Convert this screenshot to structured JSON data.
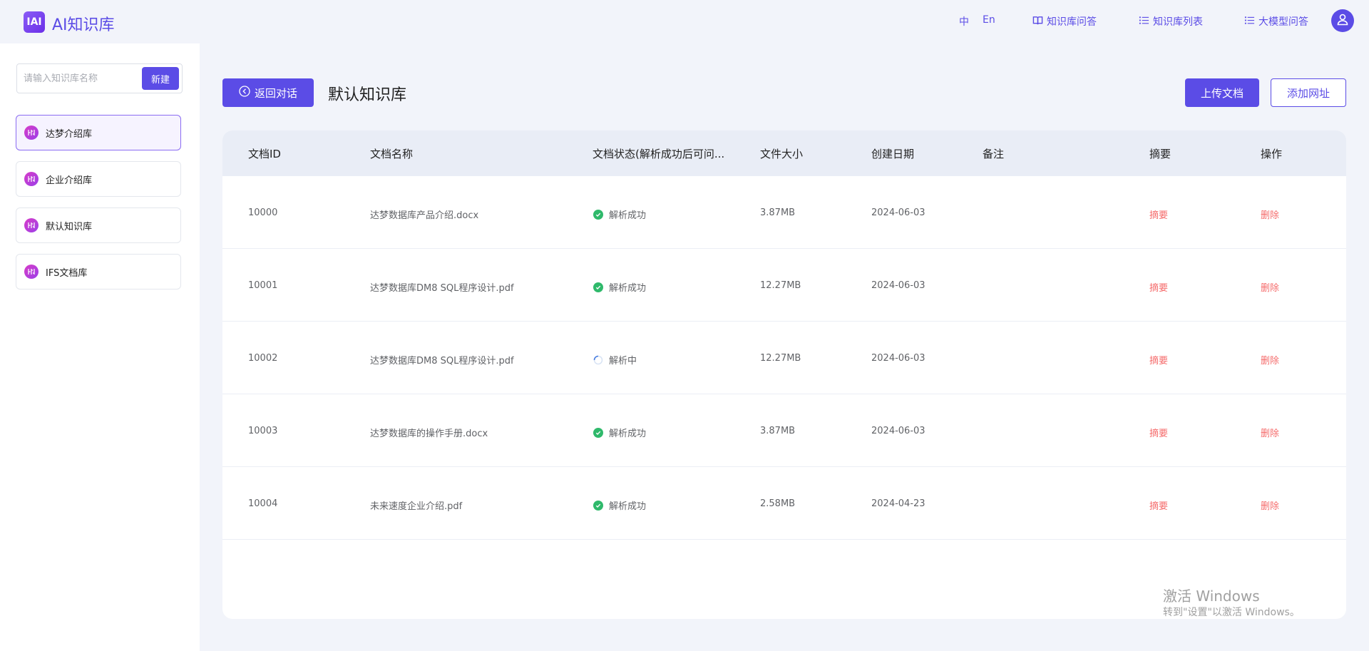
{
  "header": {
    "logo_text": "IAI",
    "title": "AI知识库",
    "lang_zh": "中",
    "lang_en": "En",
    "nav": [
      {
        "label": "知识库问答",
        "icon": "book-icon"
      },
      {
        "label": "知识库列表",
        "icon": "list-icon"
      },
      {
        "label": "大模型问答",
        "icon": "list-icon"
      }
    ],
    "accent": "#5b4ce6"
  },
  "sidebar": {
    "search_placeholder": "请输入知识库名称",
    "new_label": "新建",
    "items": [
      {
        "label": "达梦介绍库",
        "active": true
      },
      {
        "label": "企业介绍库",
        "active": false
      },
      {
        "label": "默认知识库",
        "active": false
      },
      {
        "label": "IFS文档库",
        "active": false
      }
    ]
  },
  "main": {
    "back_label": "返回对话",
    "title": "默认知识库",
    "upload_label": "上传文档",
    "add_url_label": "添加网址"
  },
  "table": {
    "columns": [
      "文档ID",
      "文档名称",
      "文档状态(解析成功后可问...",
      "文件大小",
      "创建日期",
      "备注",
      "摘要",
      "操作"
    ],
    "rows": [
      {
        "id": "10000",
        "name": "达梦数据库产品介绍.docx",
        "status": "解析成功",
        "status_type": "success",
        "size": "3.87MB",
        "date": "2024-06-03",
        "note": "",
        "summary": "摘要",
        "action": "删除"
      },
      {
        "id": "10001",
        "name": "达梦数据库DM8 SQL程序设计.pdf",
        "status": "解析成功",
        "status_type": "success",
        "size": "12.27MB",
        "date": "2024-06-03",
        "note": "",
        "summary": "摘要",
        "action": "删除"
      },
      {
        "id": "10002",
        "name": "达梦数据库DM8 SQL程序设计.pdf",
        "status": "解析中",
        "status_type": "loading",
        "size": "12.27MB",
        "date": "2024-06-03",
        "note": "",
        "summary": "摘要",
        "action": "删除"
      },
      {
        "id": "10003",
        "name": "达梦数据库的操作手册.docx",
        "status": "解析成功",
        "status_type": "success",
        "size": "3.87MB",
        "date": "2024-06-03",
        "note": "",
        "summary": "摘要",
        "action": "删除"
      },
      {
        "id": "10004",
        "name": "未来速度企业介绍.pdf",
        "status": "解析成功",
        "status_type": "success",
        "size": "2.58MB",
        "date": "2024-04-23",
        "note": "",
        "summary": "摘要",
        "action": "删除"
      }
    ]
  },
  "watermark": {
    "line1": "激活 Windows",
    "line2": "转到\"设置\"以激活 Windows。"
  }
}
